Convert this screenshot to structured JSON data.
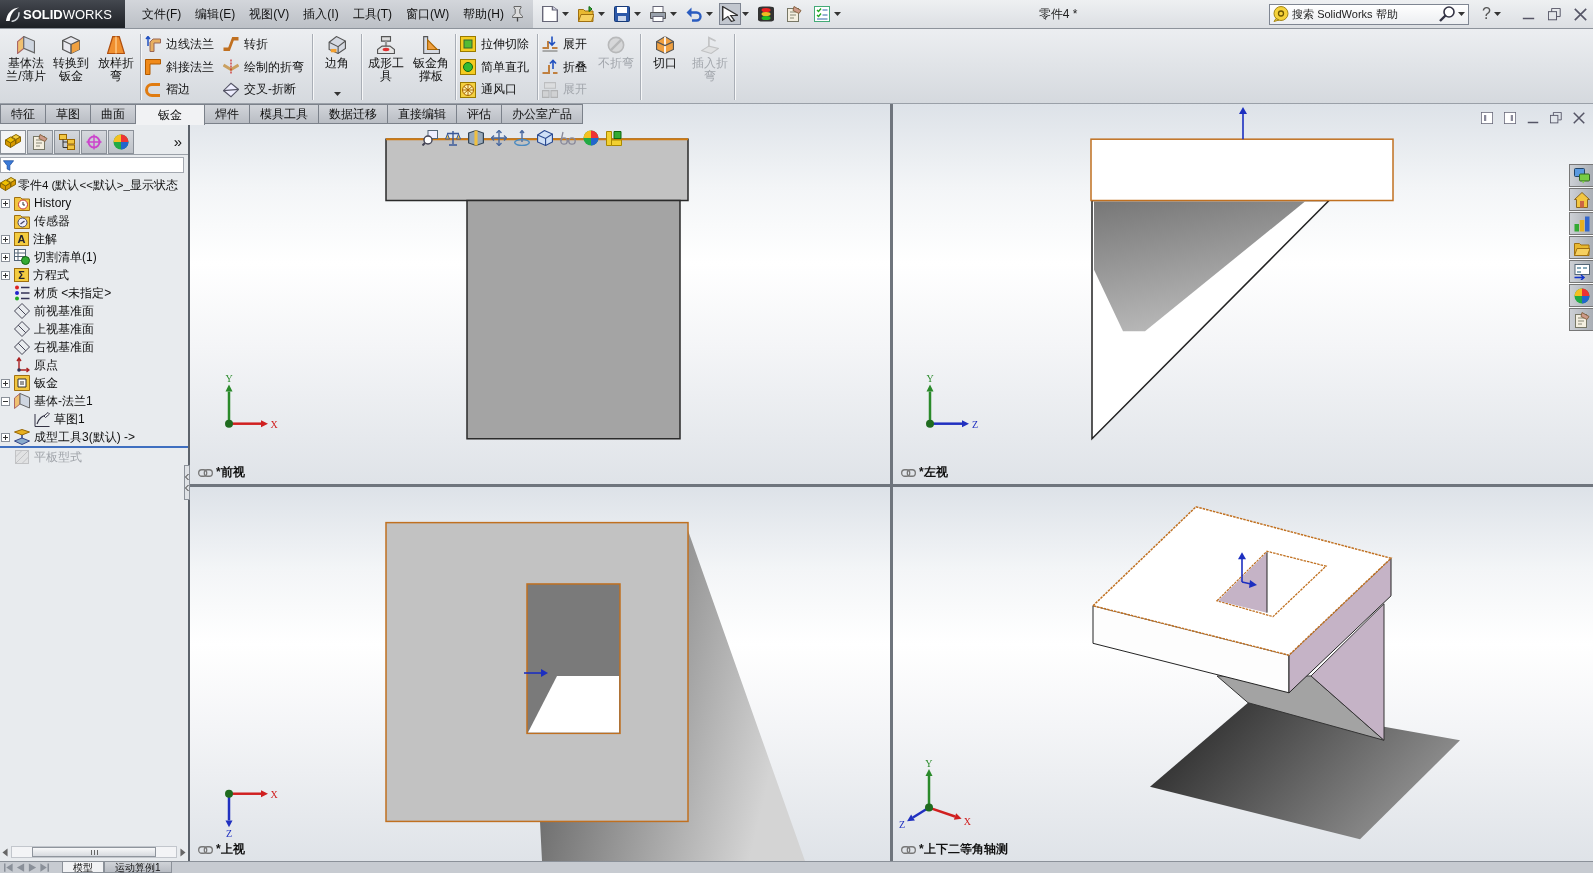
{
  "title_bar": {
    "logo": "**SOLID**WORKS",
    "menus": [
      "文件(F)",
      "编辑(E)",
      "视图(V)",
      "插入(I)",
      "工具(T)",
      "窗口(W)",
      "帮助(H)"
    ],
    "quick_access": [
      {
        "kind": "new",
        "dropdown": true,
        "pressed": false
      },
      {
        "kind": "open",
        "dropdown": true,
        "pressed": false
      },
      {
        "kind": "save",
        "dropdown": true,
        "pressed": false
      },
      {
        "kind": "print",
        "dropdown": true,
        "pressed": false
      },
      {
        "kind": "undo",
        "dropdown": true,
        "pressed": false
      },
      {
        "kind": "select",
        "dropdown": true,
        "pressed": true
      },
      {
        "kind": "rebuild",
        "dropdown": false,
        "pressed": false
      },
      {
        "kind": "options",
        "dropdown": false,
        "pressed": false
      },
      {
        "kind": "checklist",
        "dropdown": true,
        "pressed": false
      }
    ],
    "title": "零件4 *",
    "search": {
      "placeholder": "搜索 SolidWorks 帮助"
    },
    "help": "?"
  },
  "ribbon": {
    "groups": [
      {
        "tools": [
          {
            "kind": "base-flange",
            "label": "基体法兰/薄片",
            "disabled": false,
            "dropdown": false
          },
          {
            "kind": "convert",
            "label": "转换到钣金",
            "disabled": false,
            "dropdown": false
          },
          {
            "kind": "lofted-bend",
            "label": "放样折弯",
            "disabled": false,
            "dropdown": false
          }
        ]
      },
      {
        "tools": [
          {
            "stack": [
              {
                "kind": "edge-flange",
                "label": "边线法兰",
                "disabled": false
              },
              {
                "kind": "miter-flange",
                "label": "斜接法兰",
                "disabled": false
              },
              {
                "kind": "hem",
                "label": "褶边",
                "disabled": false
              }
            ]
          },
          {
            "stack": [
              {
                "kind": "jog",
                "label": "转折",
                "disabled": false
              },
              {
                "kind": "sketched-bend",
                "label": "绘制的折弯",
                "disabled": false
              },
              {
                "kind": "cross-break",
                "label": "交叉-折断",
                "disabled": false
              }
            ]
          }
        ]
      },
      {
        "tools": [
          {
            "kind": "corner",
            "label": "边角",
            "disabled": false,
            "dropdown": true
          }
        ]
      },
      {
        "tools": [
          {
            "kind": "forming-tool",
            "label": "成形工具",
            "disabled": false,
            "dropdown": false
          },
          {
            "kind": "gusset",
            "label": "钣金角撑板",
            "disabled": false,
            "dropdown": false
          }
        ]
      },
      {
        "tools": [
          {
            "stack": [
              {
                "kind": "extruded-cut",
                "label": "拉伸切除",
                "disabled": false
              },
              {
                "kind": "simple-hole",
                "label": "简单直孔",
                "disabled": false
              },
              {
                "kind": "vent",
                "label": "通风口",
                "disabled": false
              }
            ]
          }
        ]
      },
      {
        "tools": [
          {
            "stack": [
              {
                "kind": "unfold",
                "label": "展开",
                "disabled": false
              },
              {
                "kind": "fold",
                "label": "折叠",
                "disabled": false
              },
              {
                "kind": "flatten",
                "label": "展开",
                "disabled": true
              }
            ]
          },
          {
            "kind": "no-bends",
            "label": "不折弯",
            "disabled": true,
            "dropdown": false
          }
        ]
      },
      {
        "tools": [
          {
            "kind": "rip",
            "label": "切口",
            "disabled": false,
            "dropdown": false
          },
          {
            "kind": "insert-bends",
            "label": "插入折弯",
            "disabled": true,
            "dropdown": false
          }
        ]
      }
    ]
  },
  "command_tabs": [
    {
      "label": "特征",
      "selected": false
    },
    {
      "label": "草图",
      "selected": false
    },
    {
      "label": "曲面",
      "selected": false
    },
    {
      "label": "钣金",
      "selected": true
    },
    {
      "label": "焊件",
      "selected": false
    },
    {
      "label": "模具工具",
      "selected": false
    },
    {
      "label": "数据迁移",
      "selected": false
    },
    {
      "label": "直接编辑",
      "selected": false
    },
    {
      "label": "评估",
      "selected": false
    },
    {
      "label": "办公室产品",
      "selected": false
    }
  ],
  "left_panel": {
    "tabs": [
      {
        "kind": "feature-tree",
        "selected": true
      },
      {
        "kind": "property",
        "selected": false
      },
      {
        "kind": "configuration",
        "selected": false
      },
      {
        "kind": "dimxpert",
        "selected": false
      },
      {
        "kind": "display",
        "selected": false
      }
    ],
    "more": "»",
    "tree": {
      "root": {
        "kind": "part",
        "label": "零件4 (默认<<默认>_显示状态"
      },
      "items": [
        {
          "kind": "history",
          "label": "History",
          "expanded": false,
          "disabled": false
        },
        {
          "kind": "sensor",
          "label": "传感器",
          "disabled": false
        },
        {
          "kind": "glyph-folder",
          "glyph": "A",
          "label": "注解",
          "expanded": false,
          "disabled": false
        },
        {
          "kind": "cut-list",
          "label": "切割清单(1)",
          "expanded": false,
          "disabled": false
        },
        {
          "kind": "glyph-folder",
          "glyph": "Σ",
          "label": "方程式",
          "expanded": false,
          "disabled": false
        },
        {
          "kind": "material",
          "label": "材质 <未指定>",
          "disabled": false
        },
        {
          "kind": "plane",
          "label": "前视基准面",
          "disabled": false
        },
        {
          "kind": "plane",
          "label": "上视基准面",
          "disabled": false
        },
        {
          "kind": "plane",
          "label": "右视基准面",
          "disabled": false
        },
        {
          "kind": "origin",
          "label": "原点",
          "disabled": false
        },
        {
          "kind": "sheet-metal",
          "label": "钣金",
          "expanded": false,
          "disabled": false
        },
        {
          "kind": "base-flange",
          "label": "基体-法兰1",
          "expanded": true,
          "disabled": false,
          "children": [
            {
              "kind": "sketch",
              "label": "草图1",
              "disabled": false
            }
          ]
        },
        {
          "kind": "forming-tool-feature",
          "label": "成型工具3(默认) ->",
          "expanded": false,
          "disabled": false
        }
      ],
      "after_rollback": [
        {
          "kind": "flat-pattern",
          "label": "平板型式",
          "disabled": true
        }
      ]
    }
  },
  "viewport": {
    "view_toolbar": [
      {
        "kind": "zoom-fit"
      },
      {
        "kind": "zoom-area"
      },
      {
        "kind": "section-view"
      },
      {
        "kind": "pan"
      },
      {
        "kind": "rotate"
      },
      {
        "kind": "view-orientation"
      },
      {
        "kind": "hide-show"
      },
      {
        "kind": "appearance"
      },
      {
        "kind": "scene"
      }
    ],
    "panes": [
      {
        "kind": "front",
        "label": "*前视",
        "axes": [
          {
            "label": "Y",
            "kind": "up",
            "color": "#2a8a2a"
          },
          {
            "label": "X",
            "kind": "right",
            "color": "#d02020"
          }
        ]
      },
      {
        "kind": "top",
        "label": "*上视",
        "axes": [
          {
            "label": "X",
            "kind": "right",
            "color": "#d02020"
          },
          {
            "label": "Z",
            "kind": "down",
            "color": "#2030c0"
          }
        ]
      },
      {
        "kind": "left",
        "label": "*左视",
        "axes": [
          {
            "label": "Y",
            "kind": "up",
            "color": "#2a8a2a"
          },
          {
            "label": "Z",
            "kind": "right",
            "color": "#2030c0"
          }
        ]
      },
      {
        "kind": "iso",
        "label": "*上下二等角轴测",
        "axes": [
          {
            "label": "Y",
            "kind": "up",
            "color": "#2a8a2a"
          },
          {
            "label": "Z",
            "kind": "down-left",
            "color": "#2030c0"
          },
          {
            "label": "X",
            "kind": "down-right",
            "color": "#d02020"
          }
        ]
      }
    ],
    "task_pane": [
      {
        "kind": "resources"
      },
      {
        "kind": "library"
      },
      {
        "kind": "explorer"
      },
      {
        "kind": "files"
      },
      {
        "kind": "views"
      },
      {
        "kind": "appearances"
      },
      {
        "kind": "properties"
      }
    ]
  },
  "bottom_tabs": [
    {
      "label": "模型",
      "selected": true
    },
    {
      "label": "运动算例1",
      "selected": false
    }
  ]
}
